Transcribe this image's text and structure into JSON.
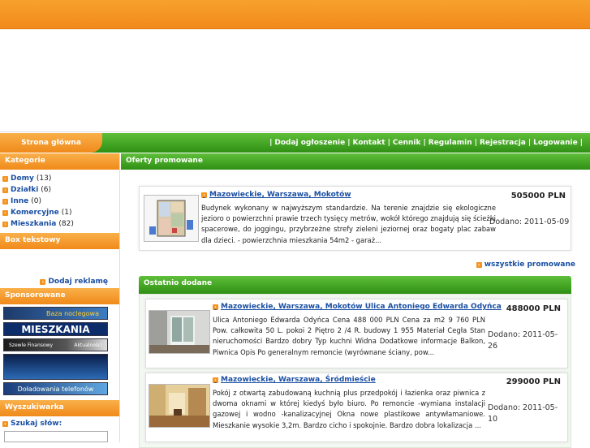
{
  "nav": {
    "home": "Strona główna",
    "links": [
      "Dodaj ogłoszenie",
      "Kontakt",
      "Cennik",
      "Regulamin",
      "Rejestracja",
      "Logowanie"
    ],
    "separator": "|"
  },
  "sidebar": {
    "categories_title": "Kategorie",
    "categories": [
      {
        "name": "Domy",
        "count": "(13)"
      },
      {
        "name": "Działki",
        "count": "(6)"
      },
      {
        "name": "Inne",
        "count": "(0)"
      },
      {
        "name": "Komercyjne",
        "count": "(1)"
      },
      {
        "name": "Mieszkania",
        "count": "(82)"
      }
    ],
    "textbox_title": "Box tekstowy",
    "add_ad": "Dodaj reklamę",
    "sponsored_title": "Sponsorowane",
    "ads": [
      "Baza noclegowa",
      "MIESZKANIA",
      "Szewle Finansowy",
      "Aktualności",
      "Doładowania telefonów"
    ],
    "search_title": "Wyszukiwarka",
    "search_label": "Szukaj słów:"
  },
  "main": {
    "promoted_title": "Oferty promowane",
    "promoted": {
      "title": "Mazowieckie, Warszawa, Mokotów",
      "description": "Budynek wykonany w najwyższym standardzie. Na terenie znajdzie się ekologiczne jezioro o powierzchni prawie trzech tysięcy metrów, wokół którego znajdują się ścieżki spacerowe, do joggingu, przybrzeżne strefy zieleni jeziornej oraz bogaty plac zabaw dla dzieci. - powierzchnia mieszkania 54m2 - garaż...",
      "price": "505000 PLN",
      "date": "Dodano: 2011-05-09"
    },
    "all_promoted": "wszystkie promowane",
    "recent_title": "Ostatnio dodane",
    "recent": [
      {
        "title": "Mazowieckie, Warszawa, Mokotów Ulica Antoniego Edwarda Odyńca",
        "description": "Ulica Antoniego Edwarda Odyńca Cena 488 000 PLN Cena za m2 9 760 PLN Pow. całkowita 50 L. pokoi 2 Piętro 2 /4 R. budowy 1 955 Materiał Cegła Stan nieruchomości Bardzo dobry Typ kuchni Widna Dodatkowe informacje Balkon, Piwnica Opis Po generalnym remoncie (wyrównane ściany, pow...",
        "price": "488000 PLN",
        "date": "Dodano: 2011-05-26"
      },
      {
        "title": "Mazowieckie, Warszawa, Śródmieście",
        "description": "Pokój z otwartą zabudowaną kuchnią plus przedpokój i łazienka oraz piwnica z dwoma oknami w której kiedyś było biuro. Po remoncie -wymiana instalacji gazowej i wodno -kanalizacyjnej Okna nowe plastikowe antywłamaniowe. Mieszkanie wysokie 3,2m. Bardzo cicho i spokojnie. Bardzo dobra lokalizacja ...",
        "price": "299000 PLN",
        "date": "Dodano: 2011-05-10"
      }
    ]
  },
  "colors": {
    "orange": "#f28a1b",
    "green": "#2e8f14",
    "link": "#1a4fa3"
  }
}
